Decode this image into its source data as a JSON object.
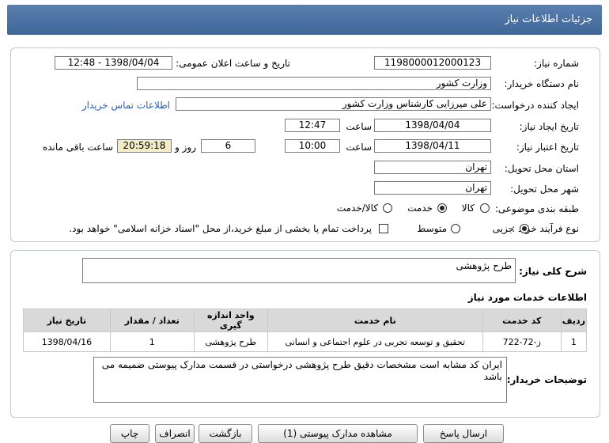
{
  "header": {
    "title": "جزئیات اطلاعات نیاز"
  },
  "form": {
    "need_number_label": "شماره نیاز:",
    "need_number": "1198000012000123",
    "announce_label": "تاریخ و ساعت اعلان عمومی:",
    "announce_value": "1398/04/04 - 12:48",
    "buyer_org_label": "نام دستگاه خریدار:",
    "buyer_org": "وزارت کشور",
    "requester_label": "ایجاد کننده درخواست:",
    "requester": "علی میرزایی کارشناس وزارت کشور",
    "contact_link": "اطلاعات تماس خریدار",
    "created_label": "تاریخ ایجاد نیاز:",
    "created_date": "1398/04/04",
    "time_label": "ساعت",
    "created_time": "12:47",
    "validity_label": "تاریخ اعتبار نیاز:",
    "validity_date": "1398/04/11",
    "validity_time": "10:00",
    "days": "6",
    "days_label": "روز و",
    "remaining_time": "20:59:18",
    "remaining_label": "ساعت باقی مانده",
    "province_label": "استان محل تحویل:",
    "province": "تهران",
    "city_label": "شهر محل تحویل:",
    "city": "تهران",
    "category_label": "طبقه بندی موضوعی:",
    "category_options": [
      "کالا",
      "خدمت",
      "کالا/خدمت"
    ],
    "category_selected": "خدمت",
    "process_label": "نوع فرآیند خرید :",
    "process_options": [
      "جزیی",
      "متوسط"
    ],
    "process_selected": "جزیی",
    "payment_note": "پرداخت تمام یا بخشی از مبلغ خرید،از محل \"اسناد خزانه اسلامی\" خواهد بود."
  },
  "summary": {
    "label": "شرح کلی نیاز:",
    "value": "طرح پژوهشی"
  },
  "services": {
    "title": "اطلاعات خدمات مورد نیاز",
    "headers": [
      "ردیف",
      "کد خدمت",
      "نام خدمت",
      "واحد اندازه گیری",
      "تعداد / مقدار",
      "تاریخ نیاز"
    ],
    "rows": [
      [
        "1",
        "ز-72-722",
        "تحقیق و توسعه تجربی در علوم اجتماعی و انسانی",
        "طرح پژوهشی",
        "1",
        "1398/04/16"
      ]
    ]
  },
  "buyer_notes": {
    "label": "توضیحات خریدار:",
    "value": "ایران کد مشابه است مشخصات دقیق طرح پژوهشی درخواستی در قسمت مدارک پیوستی ضمیمه می باشد"
  },
  "footer_buttons": {
    "reply": "ارسال پاسخ",
    "view_docs": "مشاهده مدارک پیوستی (1)",
    "back": "بازگشت",
    "print": "چاپ",
    "more": "انصراف"
  },
  "colors": {
    "title_bar": "#4a72a5",
    "highlight": "#f3ecc4",
    "link": "#2a5db0",
    "table_header": "#d9d9d9"
  }
}
